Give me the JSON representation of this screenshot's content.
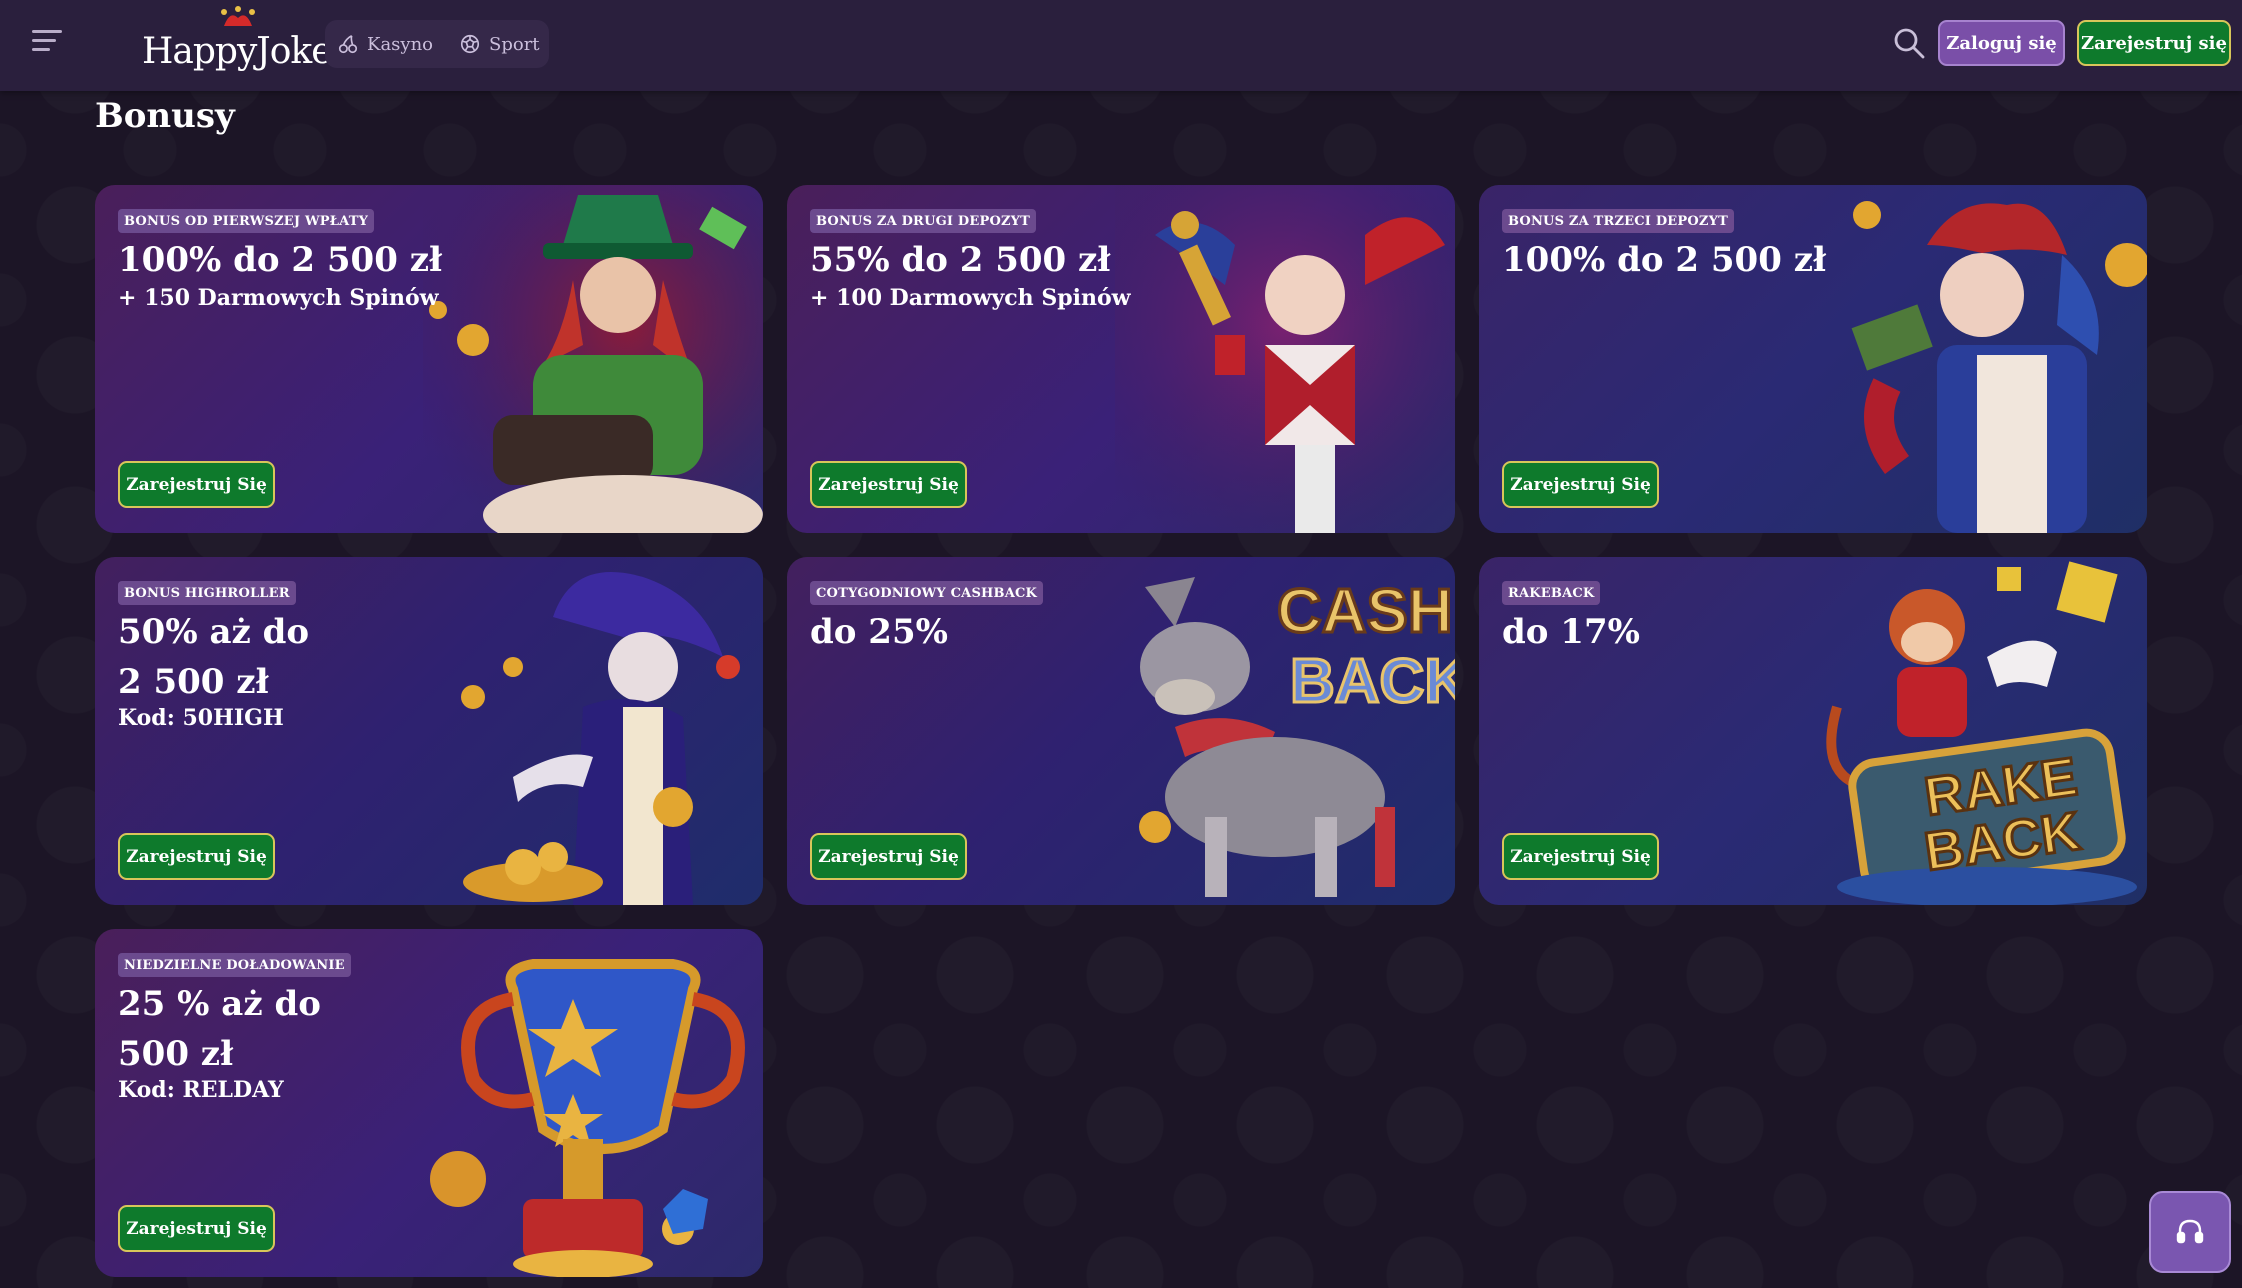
{
  "header": {
    "logo_text": "HappyJokers",
    "nav": [
      {
        "label": "Kasyno",
        "icon": "cherries-icon"
      },
      {
        "label": "Sport",
        "icon": "football-icon"
      }
    ],
    "login_label": "Zaloguj się",
    "register_label": "Zarejestruj się"
  },
  "page": {
    "title": "Bonusy"
  },
  "bonuses": [
    {
      "badge": "BONUS OD PIERWSZEJ WPŁATY",
      "headline": "100% do 2 500 zł",
      "headline2": "",
      "sub": "+ 150 Darmowych Spinów",
      "button": "Zarejestruj Się"
    },
    {
      "badge": "BONUS ZA DRUGI DEPOZYT",
      "headline": "55% do 2 500 zł",
      "headline2": "",
      "sub": "+ 100 Darmowych Spinów",
      "button": "Zarejestruj Się"
    },
    {
      "badge": "BONUS ZA TRZECI DEPOZYT",
      "headline": "100% do 2 500 zł",
      "headline2": "",
      "sub": "",
      "button": "Zarejestruj Się"
    },
    {
      "badge": "BONUS HIGHROLLER",
      "headline": "50% aż do",
      "headline2": "2 500 zł",
      "sub": "Kod: 50HIGH",
      "button": "Zarejestruj Się"
    },
    {
      "badge": "COTYGODNIOWY CASHBACK",
      "headline": "do 25%",
      "headline2": "",
      "sub": "",
      "button": "Zarejestruj Się",
      "art_text": [
        "CASH",
        "BACK"
      ]
    },
    {
      "badge": "RAKEBACK",
      "headline": "do 17%",
      "headline2": "",
      "sub": "",
      "button": "Zarejestruj Się",
      "art_text": [
        "RAKE",
        "BACK"
      ]
    },
    {
      "badge": "NIEDZIELNE DOŁADOWANIE",
      "headline": "25 % aż do",
      "headline2": "500 zł",
      "sub": "Kod: RELDAY",
      "button": "Zarejestruj Się"
    }
  ],
  "colors": {
    "header_bg": "#2a1f3d",
    "accent_green": "#0e7a2c",
    "accent_purple": "#7a4fa8",
    "gold_border": "#d8c65a"
  }
}
